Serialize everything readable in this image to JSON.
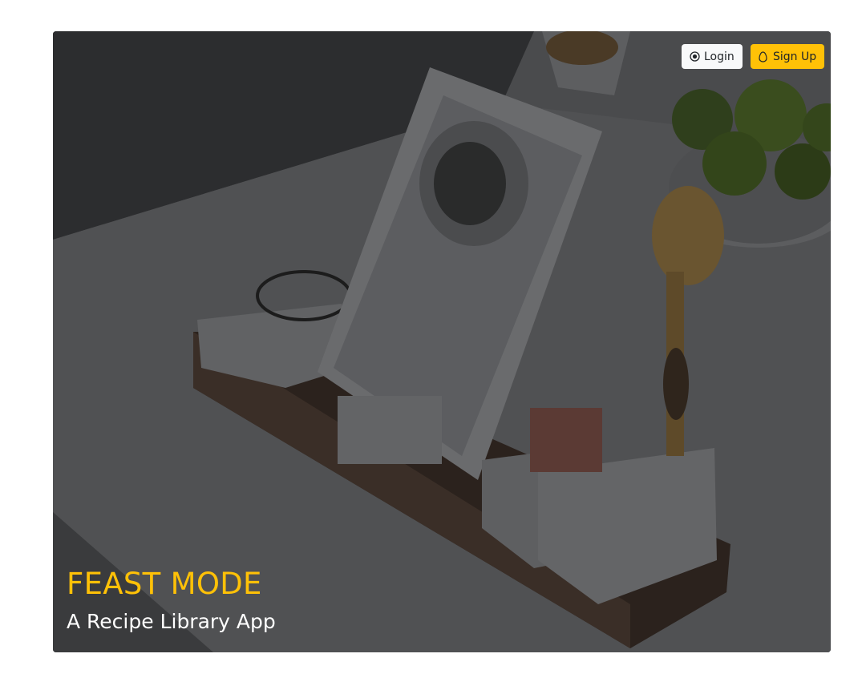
{
  "header": {
    "login_label": "Login",
    "signup_label": "Sign Up"
  },
  "hero": {
    "title": "FEAST MODE",
    "subtitle": "A Recipe Library App"
  },
  "colors": {
    "accent": "#ffc107",
    "overlay": "#3f4144",
    "login_bg": "#f8f9fa"
  },
  "icons": {
    "login": "record-circle-icon",
    "signup": "egg-icon"
  }
}
